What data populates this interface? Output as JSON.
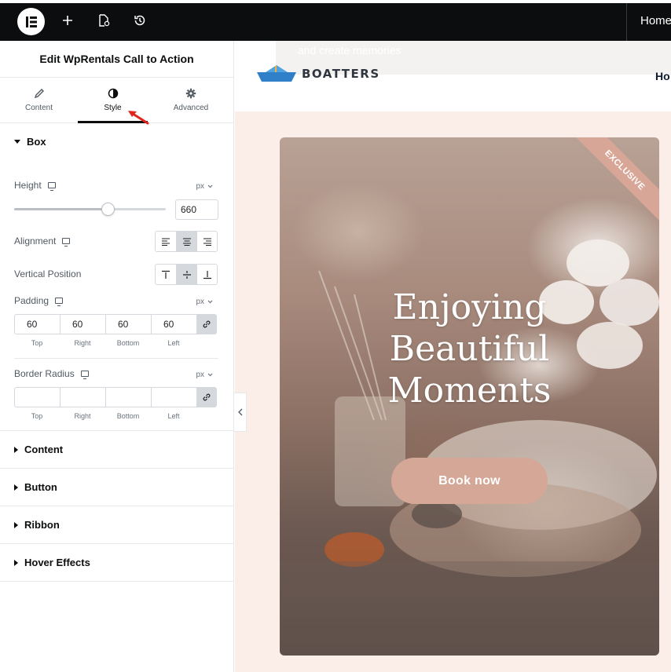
{
  "topbar": {
    "logo": "E",
    "nav_home": "Home"
  },
  "panel": {
    "title": "Edit WpRentals Call to Action",
    "tabs": [
      {
        "label": "Content",
        "icon": "pencil-icon"
      },
      {
        "label": "Style",
        "icon": "contrast-icon"
      },
      {
        "label": "Advanced",
        "icon": "gear-icon"
      }
    ],
    "box": {
      "heading": "Box",
      "height": {
        "label": "Height",
        "unit": "px",
        "value": "660",
        "slider_fraction": 0.62
      },
      "alignment": {
        "label": "Alignment",
        "selected": "center"
      },
      "vertical_position": {
        "label": "Vertical Position",
        "selected": "middle"
      },
      "padding": {
        "label": "Padding",
        "unit": "px",
        "values": [
          "60",
          "60",
          "60",
          "60"
        ],
        "labels": [
          "Top",
          "Right",
          "Bottom",
          "Left"
        ]
      },
      "border_radius": {
        "label": "Border Radius",
        "unit": "px",
        "values": [
          "",
          "",
          "",
          ""
        ],
        "labels": [
          "Top",
          "Right",
          "Bottom",
          "Left"
        ]
      }
    },
    "sections": [
      "Content",
      "Button",
      "Ribbon",
      "Hover Effects"
    ]
  },
  "preview": {
    "header_overlay_text": "and create memories",
    "brand": "BOATTERS",
    "nav_item": "Ho",
    "cta": {
      "ribbon": "EXCLUSIVE",
      "title_lines": [
        "Enjoying",
        "Beautiful",
        "Moments"
      ],
      "button": "Book now"
    }
  },
  "colors": {
    "accent": "#d4a797",
    "preview_bg": "#fbeee9",
    "topbar": "#0c0d0e"
  }
}
